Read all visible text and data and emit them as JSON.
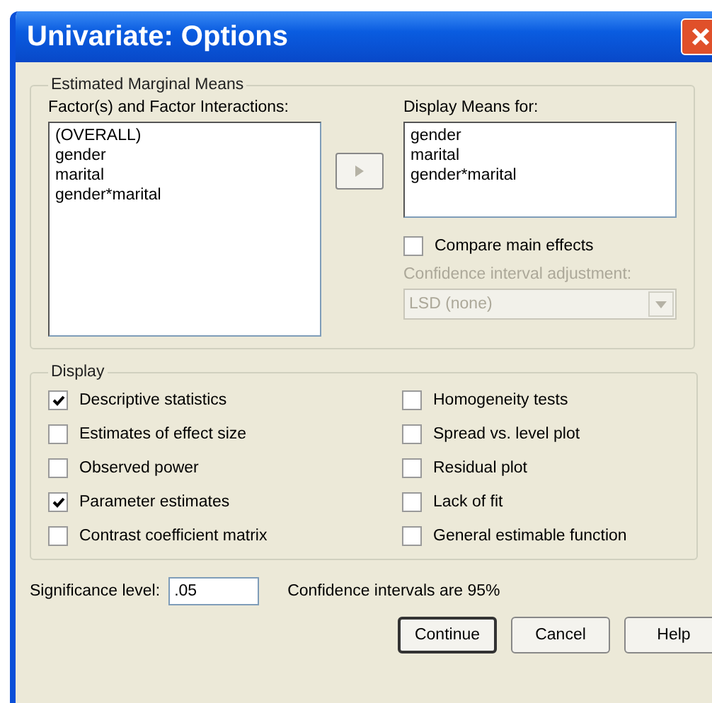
{
  "window": {
    "title": "Univariate: Options"
  },
  "estimated_marginal_means": {
    "title": "Estimated Marginal Means",
    "factors": {
      "label": "Factor(s) and Factor Interactions:",
      "items": [
        "(OVERALL)",
        "gender",
        "marital",
        "gender*marital"
      ]
    },
    "move_button": {
      "disabled": true
    },
    "display_means": {
      "label": "Display Means for:",
      "items": [
        "gender",
        "marital",
        "gender*marital"
      ]
    },
    "compare_main_effects": {
      "label": "Compare main effects",
      "checked": false
    },
    "adjustment": {
      "label": "Confidence interval adjustment:",
      "value": "LSD (none)",
      "disabled": true
    }
  },
  "display": {
    "title": "Display",
    "options": [
      {
        "label": "Descriptive statistics",
        "checked": true
      },
      {
        "label": "Estimates of effect size",
        "checked": false
      },
      {
        "label": "Observed power",
        "checked": false
      },
      {
        "label": "Parameter estimates",
        "checked": true
      },
      {
        "label": "Contrast coefficient matrix",
        "checked": false
      },
      {
        "label": "Homogeneity tests",
        "checked": false
      },
      {
        "label": "Spread vs. level plot",
        "checked": false
      },
      {
        "label": "Residual plot",
        "checked": false
      },
      {
        "label": "Lack of fit",
        "checked": false
      },
      {
        "label": "General estimable function",
        "checked": false
      }
    ]
  },
  "significance": {
    "label": "Significance level:",
    "value": ".05",
    "note": "Confidence intervals are 95%"
  },
  "buttons": [
    {
      "label": "Continue",
      "default": true
    },
    {
      "label": "Cancel",
      "default": false
    },
    {
      "label": "Help",
      "default": false
    }
  ]
}
